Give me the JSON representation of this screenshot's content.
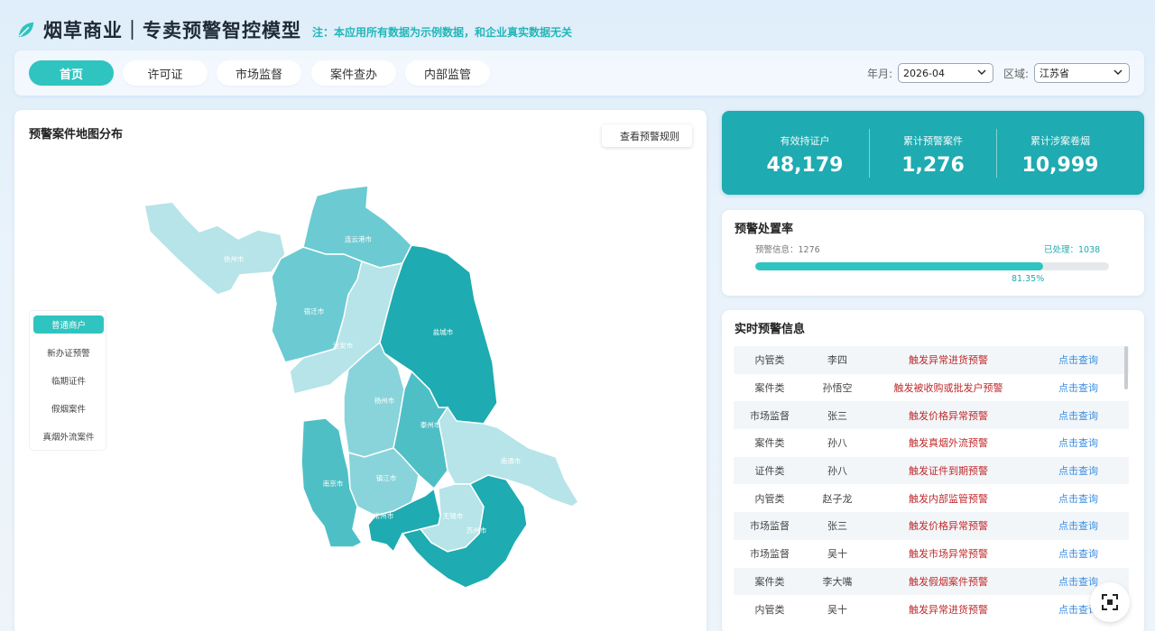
{
  "header": {
    "title": "烟草商业｜专卖预警智控模型",
    "notice": "注：本应用所有数据为示例数据，和企业真实数据无关"
  },
  "nav": {
    "tabs": [
      {
        "label": "首页",
        "active": true
      },
      {
        "label": "许可证",
        "active": false
      },
      {
        "label": "市场监督",
        "active": false
      },
      {
        "label": "案件查办",
        "active": false
      },
      {
        "label": "内部监管",
        "active": false
      }
    ],
    "month_label": "年月:",
    "month_value": "2026-04",
    "region_label": "区域:",
    "region_value": "江苏省"
  },
  "map": {
    "title": "预警案件地图分布",
    "rule_button": "查看预警规则",
    "legend": [
      {
        "label": "普通商户",
        "active": true
      },
      {
        "label": "新办证预警",
        "active": false
      },
      {
        "label": "临期证件",
        "active": false
      },
      {
        "label": "假烟案件",
        "active": false
      },
      {
        "label": "真烟外流案件",
        "active": false
      }
    ],
    "cities": [
      {
        "name": "徐州市",
        "color": "#b6e4e8"
      },
      {
        "name": "连云港市",
        "color": "#6ccbd2"
      },
      {
        "name": "宿迁市",
        "color": "#6ccbd2"
      },
      {
        "name": "淮安市",
        "color": "#b6e4e8"
      },
      {
        "name": "盐城市",
        "color": "#1eabb1"
      },
      {
        "name": "扬州市",
        "color": "#88d4da"
      },
      {
        "name": "泰州市",
        "color": "#4fbfc6"
      },
      {
        "name": "南通市",
        "color": "#b6e4e8"
      },
      {
        "name": "南京市",
        "color": "#4fbfc6"
      },
      {
        "name": "镇江市",
        "color": "#88d4da"
      },
      {
        "name": "常州市",
        "color": "#1eabb1"
      },
      {
        "name": "无锡市",
        "color": "#b6e4e8"
      },
      {
        "name": "苏州市",
        "color": "#1eabb1"
      }
    ]
  },
  "stats": [
    {
      "label": "有效持证户",
      "value": "48,179"
    },
    {
      "label": "累计预警案件",
      "value": "1,276"
    },
    {
      "label": "累计涉案卷烟",
      "value": "10,999"
    }
  ],
  "rate": {
    "title": "预警处置率",
    "info_label": "预警信息：1276",
    "handled_label": "已处理：1038",
    "percent_text": "81.35%",
    "fraction": 0.8135
  },
  "alerts": {
    "title": "实时预警信息",
    "rows": [
      {
        "type": "内管类",
        "person": "李四",
        "msg": "触发异常进货预警",
        "action": "点击查询"
      },
      {
        "type": "案件类",
        "person": "孙悟空",
        "msg": "触发被收购或批发户预警",
        "action": "点击查询"
      },
      {
        "type": "市场监督",
        "person": "张三",
        "msg": "触发价格异常预警",
        "action": "点击查询"
      },
      {
        "type": "案件类",
        "person": "孙八",
        "msg": "触发真烟外流预警",
        "action": "点击查询"
      },
      {
        "type": "证件类",
        "person": "孙八",
        "msg": "触发证件到期预警",
        "action": "点击查询"
      },
      {
        "type": "内管类",
        "person": "赵子龙",
        "msg": "触发内部监管预警",
        "action": "点击查询"
      },
      {
        "type": "市场监督",
        "person": "张三",
        "msg": "触发价格异常预警",
        "action": "点击查询"
      },
      {
        "type": "市场监督",
        "person": "吴十",
        "msg": "触发市场异常预警",
        "action": "点击查询"
      },
      {
        "type": "案件类",
        "person": "李大嘴",
        "msg": "触发假烟案件预警",
        "action": "点击查询"
      },
      {
        "type": "内管类",
        "person": "吴十",
        "msg": "触发异常进货预警",
        "action": "点击查询"
      }
    ]
  }
}
